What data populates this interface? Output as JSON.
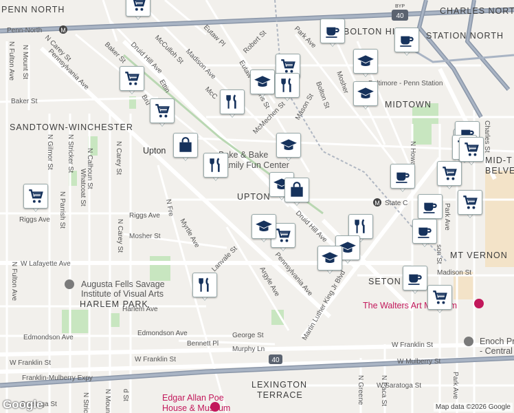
{
  "neighborhoods": {
    "penn_north": "PENN NORTH",
    "bolton_hill": "BOLTON HILL",
    "charles_north": "CHARLES NORTH",
    "station_north": "STATION NORTH",
    "midtown": "MIDTOWN",
    "sandtown": "SANDTOWN-WINCHESTER",
    "upton": "UPTON",
    "mid_town_belvedere_1": "MID-T",
    "mid_town_belvedere_2": "BELVE",
    "mt_vernon": "MT VERNON",
    "seton_hill": "SETON HI",
    "harlem_park": "HARLEM PARK",
    "lexington_1": "LEXINGTON",
    "lexington_2": "TERRACE"
  },
  "streets": {
    "penn_north_rd": "Penn-North",
    "n_fulton_ave": "N Fulton Ave",
    "n_mount_st": "N Mount St",
    "pennsylvania_ave": "Pennsylvania Ave",
    "n_carey_st_top": "N Carey St",
    "baker_st": "Baker St",
    "druid_hill_ave": "Druid Hill Ave",
    "mcculloh_st": "McCulloh St",
    "madison_ave": "Madison Ave",
    "eutaw_pl": "Eutaw Pl",
    "robert_st": "Robert St",
    "park_ave": "Park Ave",
    "mcmechen_st": "McMechen St",
    "bolton_st": "Bolton St",
    "mason_st": "Mason St",
    "baltimore_penn_station": "Baltimore - Penn Station",
    "baker_st_w": "Baker St",
    "n_gilmor_st": "N Gilmor St",
    "n_stricker_st": "N Stricker St",
    "n_calhoun_st": "N Calhoun St",
    "whatcoat_st": "Whatcoat St",
    "n_carey_st": "N Carey St",
    "riggs_ave": "Riggs Ave",
    "riggs_ave_2": "Riggs Ave",
    "n_parrish_st": "N Parrish St",
    "n_fremont": "N Fre",
    "myrtle_ave": "Myrtle Ave",
    "mosher_st": "Mosher St",
    "w_lafayette_ave": "W Lafayette Ave",
    "lanvale_st": "Lanvale St",
    "argyle_ave": "Argyle Ave",
    "pennsylvania_ave_2": "Pennsylvania Ave",
    "druid_hill_ave_2": "Druid Hill Ave",
    "mlk_blvd": "Martin Luther King Jr Blvd",
    "state_center": "State C",
    "harlem_ave": "Harlem Ave",
    "edmondson_ave": "Edmondson Ave",
    "edmondson_ave_2": "Edmondson Ave",
    "george_st": "George St",
    "bennett_pl": "Bennett Pl",
    "murphy_ln": "Murphy Ln",
    "w_franklin_st": "W Franklin St",
    "w_franklin_st_2": "W Franklin St",
    "w_franklin_st_3": "W Franklin St",
    "w_mulberry_st": "W Mulberry St",
    "franklin_mulberry_expy": "Franklin-Mulberry Expy",
    "w_saratoga_st": "W Saratoga St",
    "saratoga_st": "Saratoga St",
    "n_greene": "N Greene",
    "n_paca_st": "N Paca St",
    "park_ave_s": "Park Ave",
    "n_howard": "N Howa",
    "madison_st": "Madison St",
    "charles_st": "Charles St",
    "ross_st": "Ross St",
    "n_strick": "N Strick",
    "n_mount_st_s": "N Mount St",
    "nd_st": "d St",
    "son_st": "son St",
    "park_ave_r": "Park Ave",
    "mosher": "Mosher",
    "ettin": "Ettin",
    "bru": "Bru",
    "eutaw_laurens": "Eutaw Laurens St",
    "mcc": "McC"
  },
  "pois": {
    "bake_1": "Bake & Bake",
    "bake_2": "Family Fun Center",
    "walters": "The Walters Art Museum",
    "enoch": "Enoch Pratt",
    "enoch_2": "- Central",
    "augusta_1": "Augusta Fells Savage",
    "augusta_2": "Institute of Visual Arts",
    "edgar_1": "Edgar Allan Poe",
    "edgar_2": "House & Museum",
    "upton_station": "Upton"
  },
  "highway_shields": {
    "i40_top": "40",
    "i40_bottom": "40",
    "byp": "BYP"
  },
  "attribution": "Map data ©2026 Google",
  "google_logo": "Google",
  "markers": [
    {
      "type": "grocery"
    },
    {
      "type": "grocery"
    },
    {
      "type": "coffee"
    },
    {
      "type": "coffee"
    },
    {
      "type": "education"
    },
    {
      "type": "education"
    },
    {
      "type": "grocery"
    },
    {
      "type": "education"
    },
    {
      "type": "restaurant"
    },
    {
      "type": "restaurant"
    },
    {
      "type": "grocery"
    },
    {
      "type": "grocery"
    },
    {
      "type": "shopping"
    },
    {
      "type": "restaurant"
    },
    {
      "type": "education"
    },
    {
      "type": "education"
    },
    {
      "type": "shopping"
    },
    {
      "type": "grocery"
    },
    {
      "type": "education"
    },
    {
      "type": "grocery"
    },
    {
      "type": "coffee"
    },
    {
      "type": "grocery"
    },
    {
      "type": "coffee"
    },
    {
      "type": "grocery"
    },
    {
      "type": "coffee"
    },
    {
      "type": "restaurant"
    },
    {
      "type": "education"
    },
    {
      "type": "education"
    },
    {
      "type": "restaurant"
    },
    {
      "type": "coffee"
    },
    {
      "type": "grocery"
    },
    {
      "type": "grocery"
    },
    {
      "type": "coffee"
    },
    {
      "type": "grocery"
    }
  ]
}
